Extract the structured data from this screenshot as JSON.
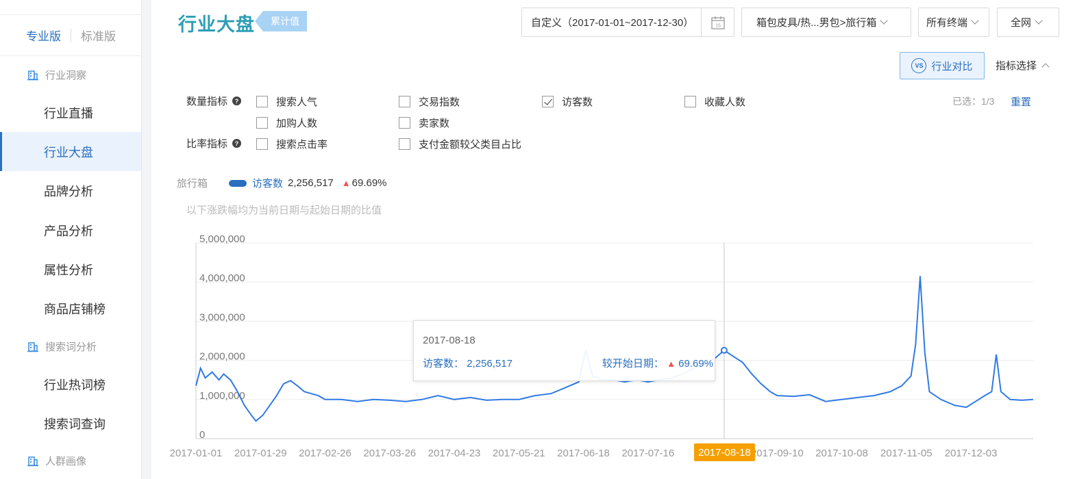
{
  "sidebar": {
    "version_pro": "专业版",
    "version_std": "标准版",
    "groups": [
      {
        "label": "行业洞察"
      },
      {
        "label": "搜索词分析"
      },
      {
        "label": "人群画像"
      }
    ],
    "items": [
      {
        "label": "行业直播"
      },
      {
        "label": "行业大盘"
      },
      {
        "label": "品牌分析"
      },
      {
        "label": "产品分析"
      },
      {
        "label": "属性分析"
      },
      {
        "label": "商品店铺榜"
      },
      {
        "label": "行业热词榜"
      },
      {
        "label": "搜索词查询"
      }
    ],
    "active_item": "行业大盘"
  },
  "header": {
    "title": "行业大盘",
    "tag": "累计值",
    "date_range": "自定义（2017-01-01~2017-12-30）",
    "category": "箱包皮具/热...男包>旅行箱",
    "terminal": "所有终端",
    "network": "全网"
  },
  "toolbar": {
    "compare_label": "行业对比",
    "vs_text": "VS",
    "metric_select_label": "指标选择"
  },
  "metrics": {
    "qty_label": "数量指标",
    "ratio_label": "比率指标",
    "qmark": "?",
    "qty_options": [
      {
        "label": "搜索人气",
        "checked": false
      },
      {
        "label": "交易指数",
        "checked": false
      },
      {
        "label": "访客数",
        "checked": true
      },
      {
        "label": "收藏人数",
        "checked": false
      },
      {
        "label": "加购人数",
        "checked": false
      },
      {
        "label": "卖家数",
        "checked": false
      }
    ],
    "ratio_options": [
      {
        "label": "搜索点击率",
        "checked": false
      },
      {
        "label": "支付金额较父类目占比",
        "checked": false
      }
    ],
    "selected_count": "已选：1/3",
    "reset_label": "重置"
  },
  "legend": {
    "category": "旅行箱",
    "series_name": "访客数",
    "value": "2,256,517",
    "change": "69.69%",
    "note": "以下涨跌幅均为当前日期与起始日期的比值"
  },
  "tooltip": {
    "date": "2017-08-18",
    "metric_label": "访客数：",
    "metric_value": "2,256,517",
    "compare_label": "较开始日期：",
    "compare_value": "69.69%"
  },
  "colors": {
    "accent": "#2a6fc0",
    "line": "#2f7ae5",
    "highlight": "#f5a000",
    "up_arrow": "#e55555"
  },
  "chart_data": {
    "type": "line",
    "x_range": [
      "2017-01-01",
      "2017-12-30"
    ],
    "ylim": [
      0,
      5000000
    ],
    "y_ticks": [
      "0",
      "1,000,000",
      "2,000,000",
      "3,000,000",
      "4,000,000",
      "5,000,000"
    ],
    "x_ticks": [
      "2017-01-01",
      "2017-01-29",
      "2017-02-26",
      "2017-03-26",
      "2017-04-23",
      "2017-05-21",
      "2017-06-18",
      "2017-07-16",
      "2017-08-18",
      "2017-09-10",
      "2017-10-08",
      "2017-11-05",
      "2017-12-03"
    ],
    "highlight_date": "2017-08-18",
    "grid": true,
    "series": [
      {
        "name": "访客数",
        "points": [
          [
            "2017-01-01",
            1350000
          ],
          [
            "2017-01-03",
            1800000
          ],
          [
            "2017-01-05",
            1550000
          ],
          [
            "2017-01-08",
            1700000
          ],
          [
            "2017-01-11",
            1500000
          ],
          [
            "2017-01-13",
            1650000
          ],
          [
            "2017-01-16",
            1500000
          ],
          [
            "2017-01-19",
            1200000
          ],
          [
            "2017-01-22",
            850000
          ],
          [
            "2017-01-25",
            600000
          ],
          [
            "2017-01-27",
            450000
          ],
          [
            "2017-01-30",
            600000
          ],
          [
            "2017-02-02",
            850000
          ],
          [
            "2017-02-05",
            1100000
          ],
          [
            "2017-02-08",
            1400000
          ],
          [
            "2017-02-11",
            1480000
          ],
          [
            "2017-02-14",
            1350000
          ],
          [
            "2017-02-17",
            1200000
          ],
          [
            "2017-02-20",
            1150000
          ],
          [
            "2017-02-23",
            1100000
          ],
          [
            "2017-02-26",
            1000000
          ],
          [
            "2017-03-05",
            1000000
          ],
          [
            "2017-03-12",
            950000
          ],
          [
            "2017-03-19",
            1000000
          ],
          [
            "2017-03-26",
            980000
          ],
          [
            "2017-04-02",
            950000
          ],
          [
            "2017-04-09",
            1000000
          ],
          [
            "2017-04-16",
            1100000
          ],
          [
            "2017-04-23",
            1000000
          ],
          [
            "2017-04-30",
            1050000
          ],
          [
            "2017-05-07",
            980000
          ],
          [
            "2017-05-14",
            1000000
          ],
          [
            "2017-05-21",
            1000000
          ],
          [
            "2017-05-28",
            1100000
          ],
          [
            "2017-06-04",
            1150000
          ],
          [
            "2017-06-08",
            1250000
          ],
          [
            "2017-06-12",
            1350000
          ],
          [
            "2017-06-16",
            1450000
          ],
          [
            "2017-06-19",
            2250000
          ],
          [
            "2017-06-22",
            1600000
          ],
          [
            "2017-06-26",
            1500000
          ],
          [
            "2017-07-01",
            1500000
          ],
          [
            "2017-07-06",
            1450000
          ],
          [
            "2017-07-11",
            1500000
          ],
          [
            "2017-07-16",
            1450000
          ],
          [
            "2017-07-21",
            1500000
          ],
          [
            "2017-07-26",
            1550000
          ],
          [
            "2017-07-31",
            1650000
          ],
          [
            "2017-08-05",
            1800000
          ],
          [
            "2017-08-10",
            1900000
          ],
          [
            "2017-08-14",
            2050000
          ],
          [
            "2017-08-18",
            2256517
          ],
          [
            "2017-08-22",
            2100000
          ],
          [
            "2017-08-26",
            1950000
          ],
          [
            "2017-08-30",
            1650000
          ],
          [
            "2017-09-03",
            1400000
          ],
          [
            "2017-09-07",
            1200000
          ],
          [
            "2017-09-10",
            1100000
          ],
          [
            "2017-09-17",
            1080000
          ],
          [
            "2017-09-24",
            1120000
          ],
          [
            "2017-10-01",
            950000
          ],
          [
            "2017-10-08",
            1000000
          ],
          [
            "2017-10-15",
            1050000
          ],
          [
            "2017-10-22",
            1100000
          ],
          [
            "2017-10-29",
            1200000
          ],
          [
            "2017-11-03",
            1350000
          ],
          [
            "2017-11-07",
            1600000
          ],
          [
            "2017-11-09",
            2400000
          ],
          [
            "2017-11-11",
            4150000
          ],
          [
            "2017-11-13",
            2200000
          ],
          [
            "2017-11-15",
            1200000
          ],
          [
            "2017-11-20",
            1000000
          ],
          [
            "2017-11-26",
            850000
          ],
          [
            "2017-12-01",
            800000
          ],
          [
            "2017-12-05",
            950000
          ],
          [
            "2017-12-09",
            1100000
          ],
          [
            "2017-12-12",
            1200000
          ],
          [
            "2017-12-14",
            2150000
          ],
          [
            "2017-12-16",
            1200000
          ],
          [
            "2017-12-20",
            1000000
          ],
          [
            "2017-12-25",
            980000
          ],
          [
            "2017-12-30",
            1000000
          ]
        ]
      }
    ]
  }
}
